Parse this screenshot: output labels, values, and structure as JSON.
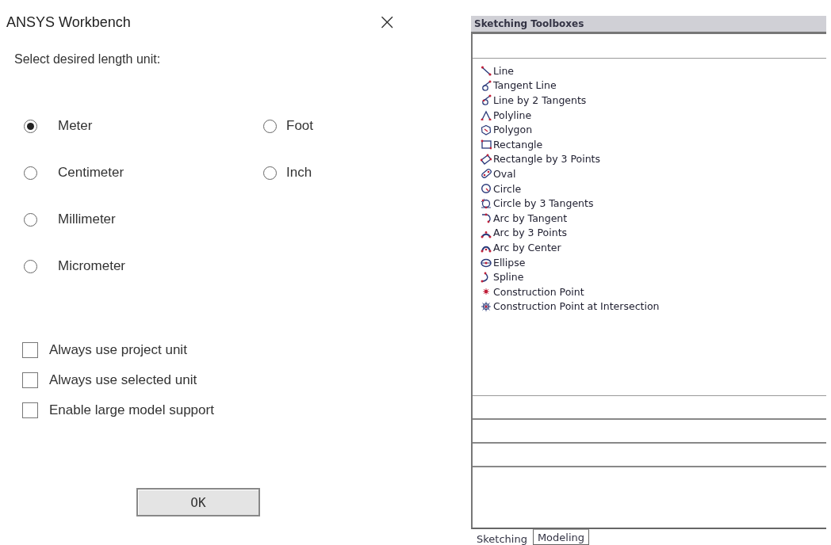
{
  "dialog": {
    "title": "ANSYS Workbench",
    "close": "×",
    "prompt": "Select desired length unit:",
    "units": [
      {
        "label": "Meter",
        "selected": true
      },
      {
        "label": "Centimeter",
        "selected": false
      },
      {
        "label": "Millimeter",
        "selected": false
      },
      {
        "label": "Micrometer",
        "selected": false
      },
      {
        "label": "Foot",
        "selected": false
      },
      {
        "label": "Inch",
        "selected": false
      }
    ],
    "options": [
      {
        "label": "Always use project unit",
        "checked": false
      },
      {
        "label": "Always use selected unit",
        "checked": false
      },
      {
        "label": "Enable large model support",
        "checked": false
      }
    ],
    "ok_button": "OK"
  },
  "toolbox": {
    "title": "Sketching Toolboxes",
    "tools": [
      "Line",
      "Tangent Line",
      "Line by 2 Tangents",
      "Polyline",
      "Polygon",
      "Rectangle",
      "Rectangle by 3 Points",
      "Oval",
      "Circle",
      "Circle by 3 Tangents",
      "Arc by Tangent",
      "Arc by 3 Points",
      "Arc by Center",
      "Ellipse",
      "Spline",
      "Construction Point",
      "Construction Point at Intersection"
    ],
    "tabs": [
      {
        "label": "Sketching",
        "selected": true
      },
      {
        "label": "Modeling",
        "selected": false
      }
    ]
  }
}
